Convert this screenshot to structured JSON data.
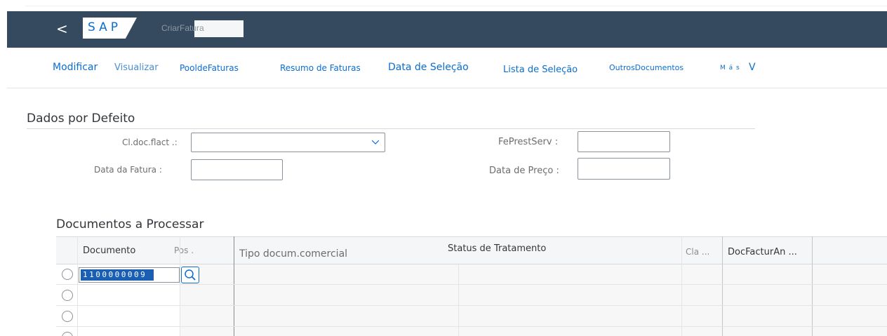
{
  "shell": {
    "back_symbol": "<",
    "logo_text": "SAP",
    "title": "CriarFatura"
  },
  "toolbar": {
    "items": [
      "Modificar",
      "Visualizar",
      "PooldeFaturas",
      "Resumo de Faturas",
      "Data de Seleção",
      "Lista de Seleção",
      "OutrosDocumentos",
      "M á s",
      "V"
    ]
  },
  "defaults": {
    "title": "Dados por Defeito",
    "cl_doc_label": "Cl.doc.flact .:",
    "cl_doc_value": "",
    "fe_prest_label": "FePrestServ :",
    "fe_prest_value": "",
    "invoice_date_label": "Data da Fatura :",
    "invoice_date_value": "",
    "price_date_label": "Data de Preço :",
    "price_date_value": ""
  },
  "documents": {
    "title": "Documentos a Processar",
    "columns": [
      "Documento",
      "Pos .",
      "Tipo docum.comercial",
      "Status de Tratamento",
      "Cla ...",
      "DocFacturAn ..."
    ],
    "rows": [
      {
        "document": "1100000009"
      },
      {
        "document": ""
      },
      {
        "document": ""
      },
      {
        "document": ""
      }
    ]
  }
}
